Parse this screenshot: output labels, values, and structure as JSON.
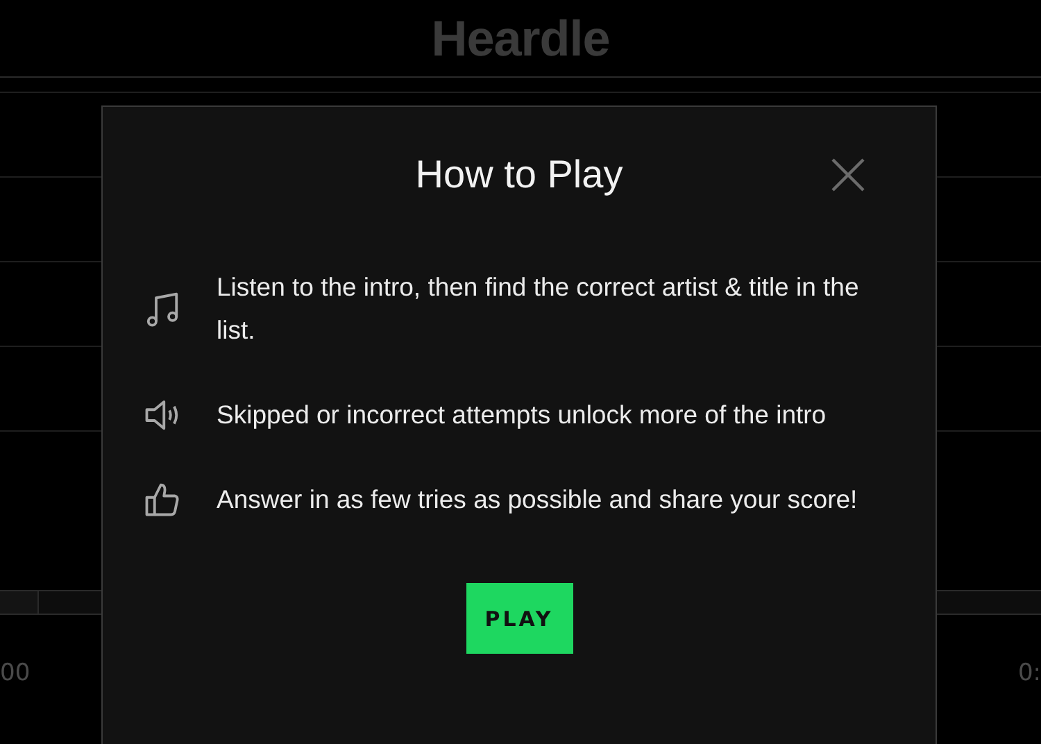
{
  "app": {
    "title": "Heardle",
    "time_start": "00",
    "time_end": "0:"
  },
  "modal": {
    "title": "How to Play",
    "items": [
      {
        "kind": "music",
        "text": "Listen to the intro, then find the correct artist & title in the list."
      },
      {
        "kind": "speaker",
        "text": "Skipped or incorrect attempts unlock more of the intro"
      },
      {
        "kind": "thumb",
        "text": "Answer in as few tries as possible and share your score!"
      }
    ],
    "button": "PLAY"
  }
}
